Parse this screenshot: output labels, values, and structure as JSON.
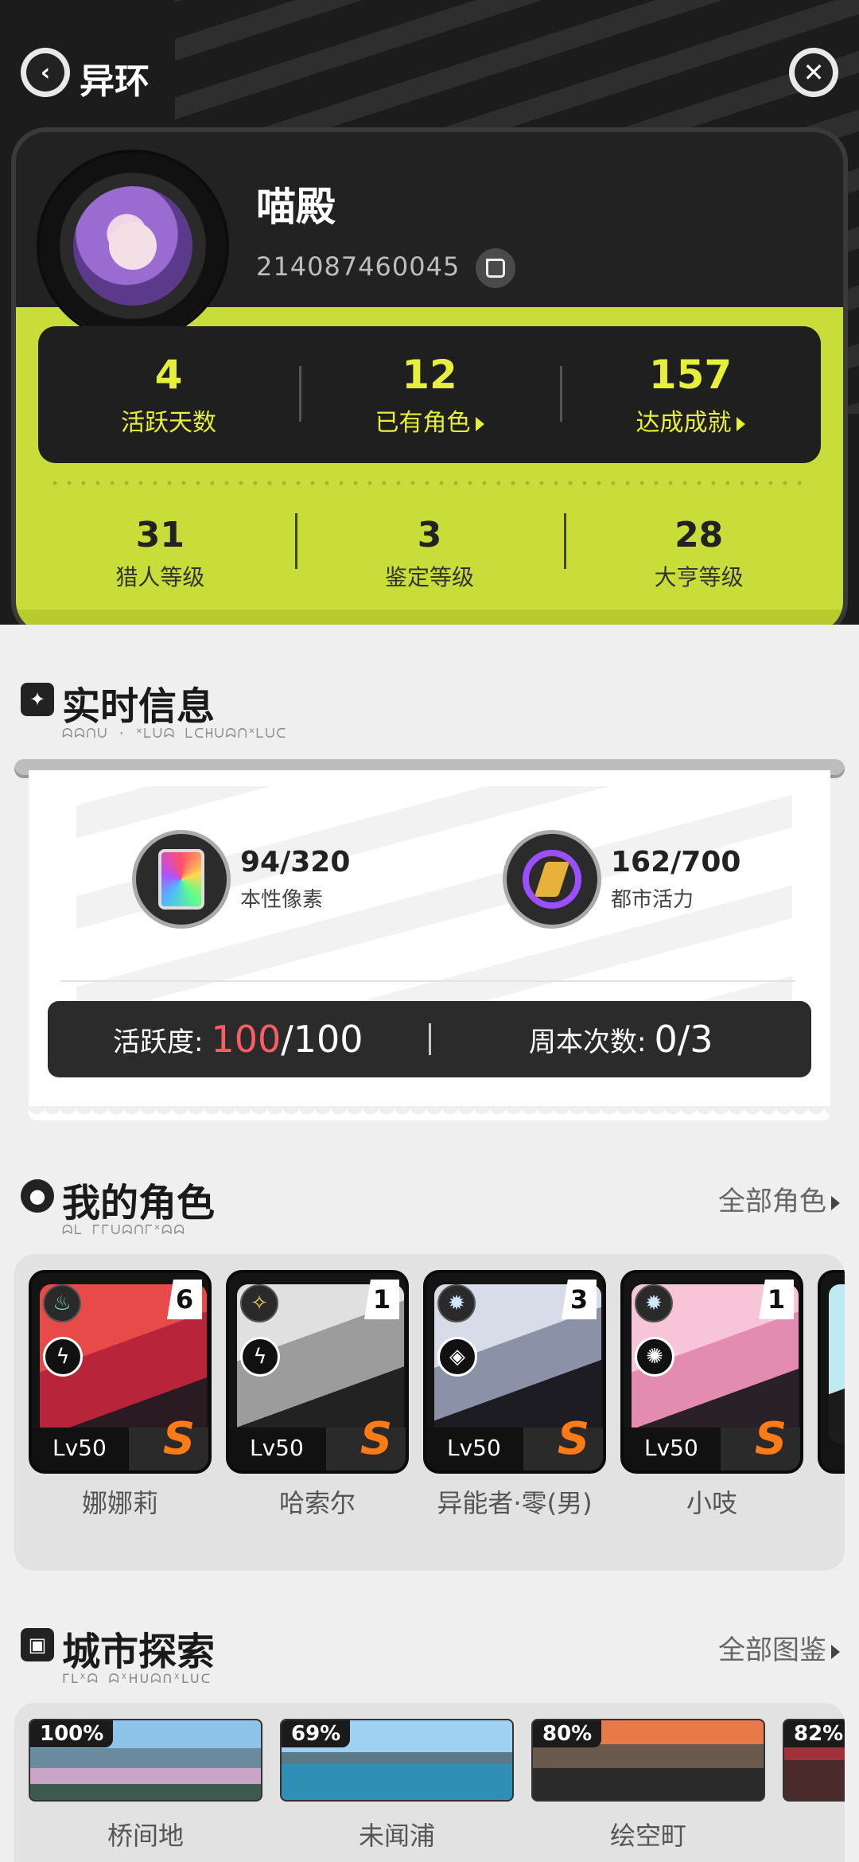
{
  "header": {
    "title": "异环",
    "back_icon": "chevron-left-icon",
    "close_icon": "close-icon"
  },
  "profile": {
    "name": "喵殿",
    "uid": "214087460045",
    "stats": [
      {
        "value": "4",
        "label": "活跃天数",
        "has_arrow": false
      },
      {
        "value": "12",
        "label": "已有角色",
        "has_arrow": true
      },
      {
        "value": "157",
        "label": "达成成就",
        "has_arrow": true
      }
    ],
    "levels": [
      {
        "value": "31",
        "label": "猎人等级"
      },
      {
        "value": "3",
        "label": "鉴定等级"
      },
      {
        "value": "28",
        "label": "大亨等级"
      }
    ],
    "accent_color": "#c8dd3a"
  },
  "realtime": {
    "title": "实时信息",
    "subtitle": "ᗣᗣᑎᑌ · ᕽᒪᑌᗣ ᒪᑕᕼᑌᗣᑎᕽᒪᑌᑕ",
    "resources": [
      {
        "value": "94/320",
        "label": "本性像素",
        "icon": "prism-card-icon"
      },
      {
        "value": "162/700",
        "label": "都市活力",
        "icon": "energy-bolt-icon"
      }
    ],
    "activity_label": "活跃度:",
    "activity_current": "100",
    "activity_max": "/100",
    "weekly_label": "周本次数:",
    "weekly_value": "0/3",
    "highlight_color": "#ff5d63"
  },
  "characters": {
    "title": "我的角色",
    "subtitle": "ᗣᒪ ᒥᒥᑌᗣᑎᒥᕽᗣᗣ",
    "link": "全部角色",
    "items": [
      {
        "name": "娜娜莉",
        "level": "Lv50",
        "rank": "6",
        "grade": "S"
      },
      {
        "name": "哈索尔",
        "level": "Lv50",
        "rank": "1",
        "grade": "S"
      },
      {
        "name": "异能者·零(男)",
        "level": "Lv50",
        "rank": "3",
        "grade": "S"
      },
      {
        "name": "小吱",
        "level": "Lv50",
        "rank": "1",
        "grade": "S"
      }
    ]
  },
  "city": {
    "title": "城市探索",
    "subtitle": "ᒥᒪᕽᗣ ᗣᕽᕼᑌᗣᑎᕽᒪᑌᑕ",
    "link": "全部图鉴",
    "items": [
      {
        "name": "桥间地",
        "percent": "100%"
      },
      {
        "name": "未闻浦",
        "percent": "69%"
      },
      {
        "name": "绘空町",
        "percent": "80%"
      },
      {
        "name": "",
        "percent": "82%"
      }
    ]
  }
}
